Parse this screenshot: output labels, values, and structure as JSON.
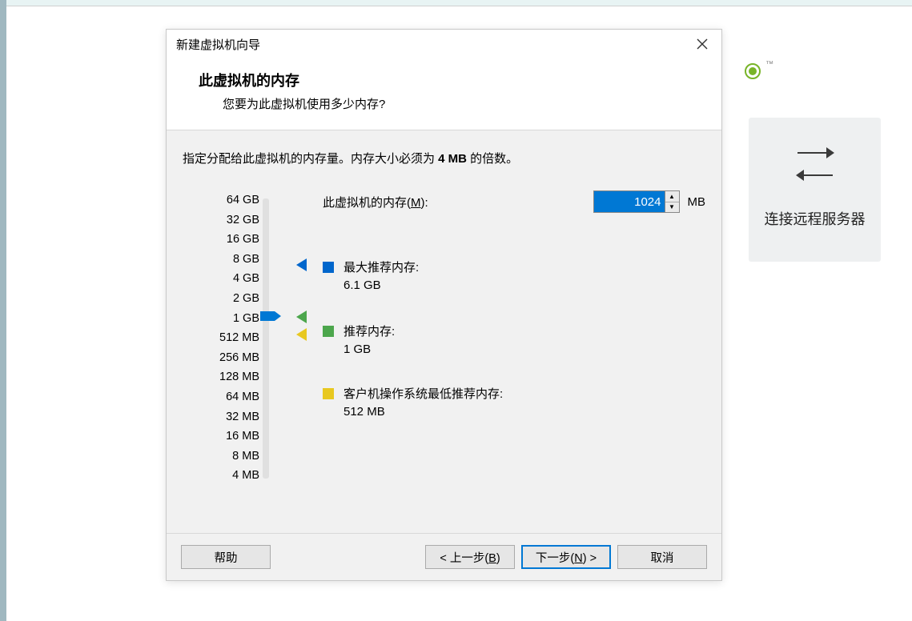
{
  "dialog": {
    "title": "新建虚拟机向导",
    "heading": "此虚拟机的内存",
    "subtitle": "您要为此虚拟机使用多少内存?",
    "instruction_prefix": "指定分配给此虚拟机的内存量。内存大小必须为 ",
    "instruction_bold": "4 MB",
    "instruction_suffix": " 的倍数。",
    "mem_label_prefix": "此虚拟机的内存(",
    "mem_label_hotkey": "M",
    "mem_label_suffix": "):",
    "mem_value": "1024",
    "mem_unit": "MB",
    "scale": [
      "64 GB",
      "32 GB",
      "16 GB",
      "8 GB",
      "4 GB",
      "2 GB",
      "1 GB",
      "512 MB",
      "256 MB",
      "128 MB",
      "64 MB",
      "32 MB",
      "16 MB",
      "8 MB",
      "4 MB"
    ],
    "recommendations": {
      "max": {
        "label": "最大推荐内存:",
        "value": "6.1 GB",
        "color": "#0066cc"
      },
      "rec": {
        "label": "推荐内存:",
        "value": "1 GB",
        "color": "#4ca64c"
      },
      "min": {
        "label": "客户机操作系统最低推荐内存:",
        "value": "512 MB",
        "color": "#e8c820"
      }
    },
    "buttons": {
      "help": "帮助",
      "back_prefix": "< 上一步(",
      "back_hotkey": "B",
      "back_suffix": ")",
      "next_prefix": "下一步(",
      "next_hotkey": "N",
      "next_suffix": ") >",
      "cancel": "取消"
    }
  },
  "sidecard": {
    "label": "连接远程服务器"
  }
}
